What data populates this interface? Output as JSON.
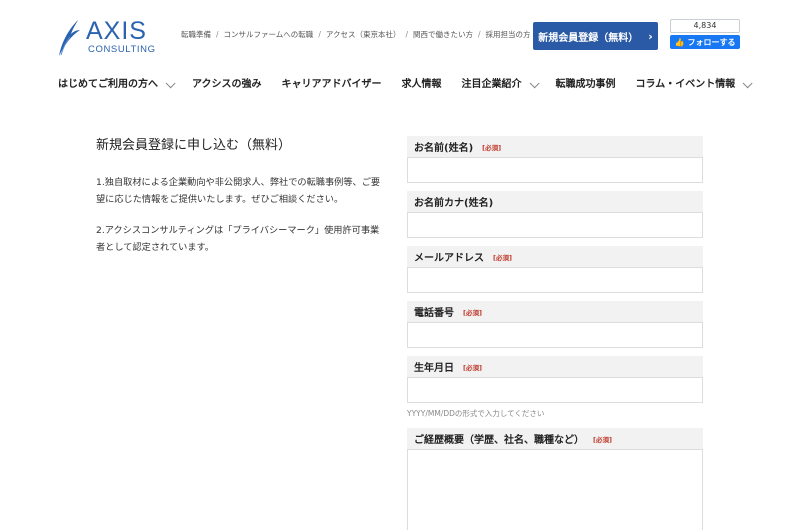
{
  "header": {
    "logo_main": "AXIS",
    "logo_sub": "CONSULTING",
    "brand_color": "#2a63b0",
    "top_links": [
      "転職準備",
      "コンサルファームへの転職",
      "アクセス（東京本社）",
      "関西で働きたい方",
      "採用担当の方"
    ],
    "register_button": "新規会員登録（無料）",
    "register_chevron": "›",
    "fb_count": "4,834",
    "fb_follow": "フォローする"
  },
  "nav": {
    "items": [
      {
        "label": "はじめてご利用の方へ",
        "dropdown": true
      },
      {
        "label": "アクシスの強み",
        "dropdown": false
      },
      {
        "label": "キャリアアドバイザー",
        "dropdown": false
      },
      {
        "label": "求人情報",
        "dropdown": false
      },
      {
        "label": "注目企業紹介",
        "dropdown": true
      },
      {
        "label": "転職成功事例",
        "dropdown": false
      },
      {
        "label": "コラム・イベント情報",
        "dropdown": true
      }
    ]
  },
  "intro": {
    "title": "新規会員登録に申し込む（無料）",
    "para1": "1.独自取材による企業動向や非公開求人、弊社での転職事例等、ご要望に応じた情報をご提供いたします。ぜひご相談ください。",
    "para2": "2.アクシスコンサルティングは「プライバシーマーク」使用許可事業者として認定されています。"
  },
  "form": {
    "required_label": "[必須]",
    "name": {
      "label": "お名前(姓名)",
      "value": ""
    },
    "kana": {
      "label": "お名前カナ(姓名)",
      "value": ""
    },
    "email": {
      "label": "メールアドレス",
      "value": ""
    },
    "phone": {
      "label": "電話番号",
      "value": ""
    },
    "birthday": {
      "label": "生年月日",
      "value": "",
      "hint": "YYYY/MM/DDの形式で入力してください"
    },
    "career": {
      "label": "ご経歴概要（学歴、社名、職種など）",
      "value": ""
    }
  }
}
